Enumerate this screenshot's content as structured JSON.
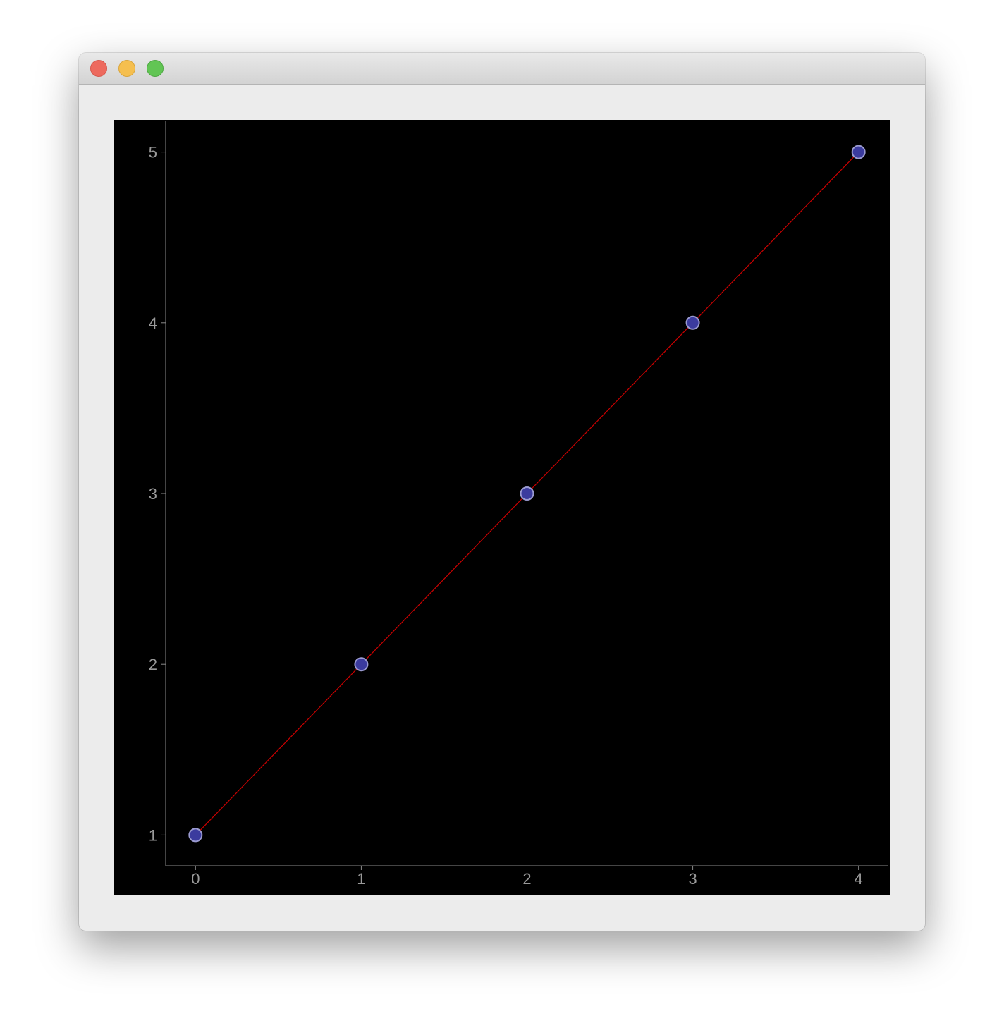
{
  "window": {
    "controls": [
      "close-icon",
      "minimize-icon",
      "zoom-icon"
    ]
  },
  "chart_data": {
    "type": "line",
    "x": [
      0,
      1,
      2,
      3,
      4
    ],
    "series": [
      {
        "values": [
          1,
          2,
          3,
          4,
          5
        ]
      }
    ],
    "xlabel": "",
    "ylabel": "",
    "xlim": [
      -0.18,
      4.18
    ],
    "ylim": [
      0.82,
      5.18
    ],
    "xticks": [
      "0",
      "1",
      "2",
      "3",
      "4"
    ],
    "yticks": [
      "1",
      "2",
      "3",
      "4",
      "5"
    ],
    "grid": false,
    "background": "#000000",
    "axis_color": "#8a8a8a",
    "tick_label_color": "#9a9a9a",
    "line_color": "#cc0000",
    "marker_fill": "#3b3b9e",
    "marker_stroke": "#9a9ad0"
  }
}
